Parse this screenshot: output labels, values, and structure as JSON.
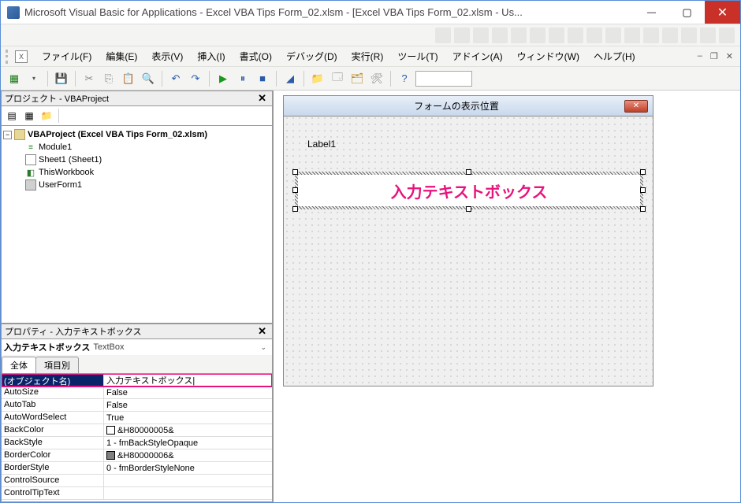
{
  "window": {
    "title": "Microsoft Visual Basic for Applications - Excel VBA Tips Form_02.xlsm - [Excel VBA Tips Form_02.xlsm - Us..."
  },
  "menu": {
    "file": "ファイル(F)",
    "edit": "編集(E)",
    "view": "表示(V)",
    "insert": "挿入(I)",
    "format": "書式(O)",
    "debug": "デバッグ(D)",
    "run": "実行(R)",
    "tools": "ツール(T)",
    "addin": "アドイン(A)",
    "window": "ウィンドウ(W)",
    "help": "ヘルプ(H)"
  },
  "project_panel": {
    "title": "プロジェクト - VBAProject",
    "root": "VBAProject (Excel VBA Tips Form_02.xlsm)",
    "items": {
      "module1": "Module1",
      "sheet1": "Sheet1 (Sheet1)",
      "thiswb": "ThisWorkbook",
      "userform1": "UserForm1"
    }
  },
  "properties_panel": {
    "title": "プロパティ - 入力テキストボックス",
    "object_name": "入力テキストボックス",
    "object_type": "TextBox",
    "tab_all": "全体",
    "tab_cat": "項目別",
    "rows": [
      {
        "k": "(オブジェクト名)",
        "v": "入力テキストボックス|",
        "hl": true
      },
      {
        "k": "AutoSize",
        "v": "False"
      },
      {
        "k": "AutoTab",
        "v": "False"
      },
      {
        "k": "AutoWordSelect",
        "v": "True"
      },
      {
        "k": "BackColor",
        "v": "&H80000005&",
        "sw": "#ffffff"
      },
      {
        "k": "BackStyle",
        "v": "1 - fmBackStyleOpaque"
      },
      {
        "k": "BorderColor",
        "v": "&H80000006&",
        "sw": "#808080"
      },
      {
        "k": "BorderStyle",
        "v": "0 - fmBorderStyleNone"
      },
      {
        "k": "ControlSource",
        "v": ""
      },
      {
        "k": "ControlTipText",
        "v": ""
      }
    ]
  },
  "form": {
    "title": "フォームの表示位置",
    "label1": "Label1",
    "textbox_text": "入力テキストボックス"
  }
}
